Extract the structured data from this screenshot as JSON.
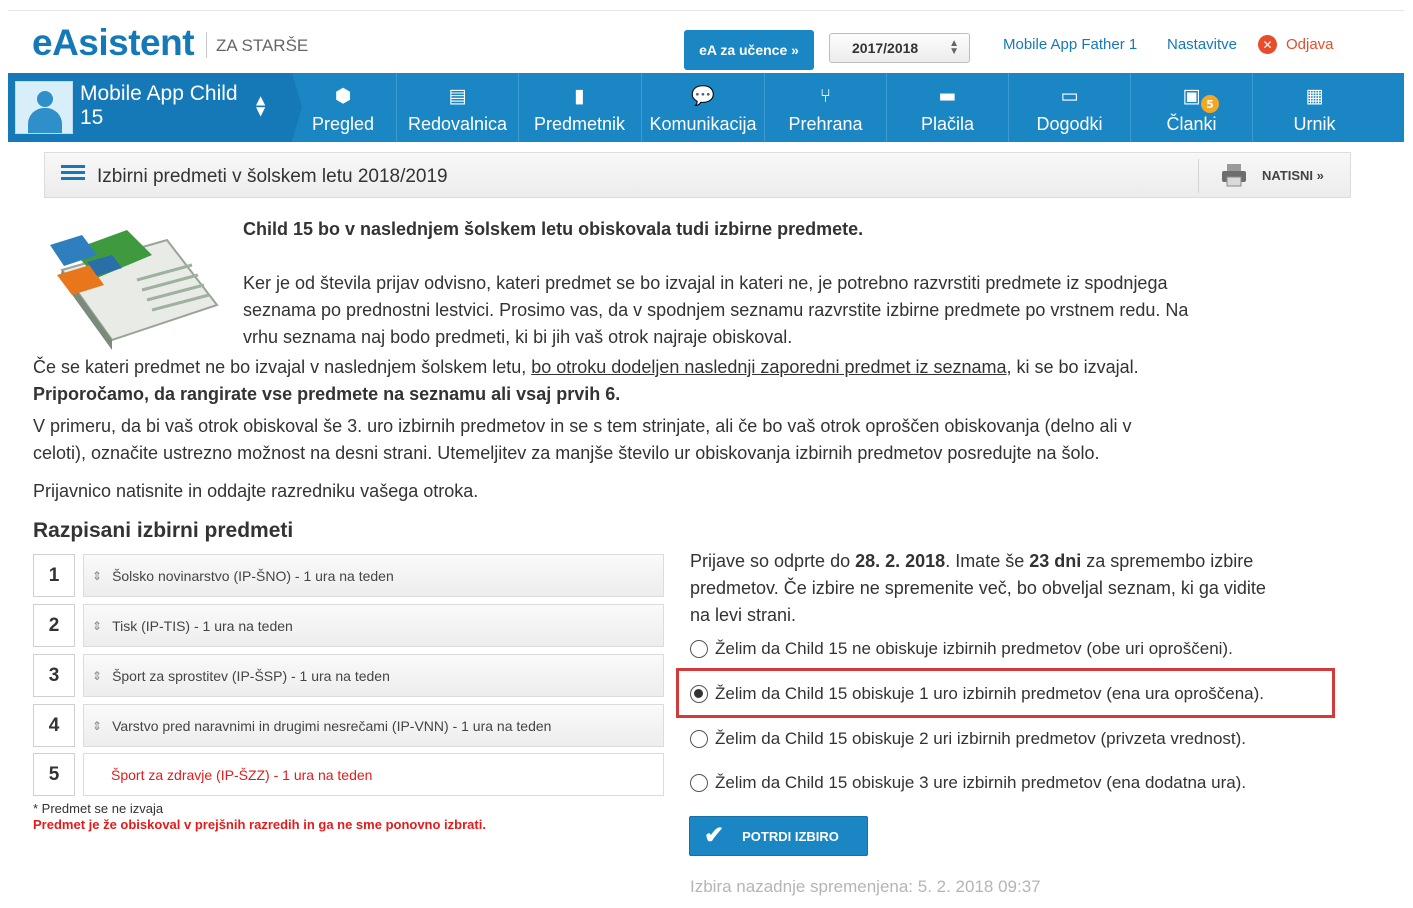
{
  "header": {
    "logo": "eAsistent",
    "logo_sub": "ZA STARŠE",
    "ea_button": "eA za učence »",
    "year": "2017/2018",
    "user": "Mobile App Father 1",
    "settings": "Nastavitve",
    "logout": "Odjava"
  },
  "nav": {
    "child_name": "Mobile App Child 15",
    "items": [
      {
        "label": "Pregled",
        "icon": "cube-icon"
      },
      {
        "label": "Redovalnica",
        "icon": "gradebook-icon"
      },
      {
        "label": "Predmetnik",
        "icon": "book-icon"
      },
      {
        "label": "Komunikacija",
        "icon": "chat-icon"
      },
      {
        "label": "Prehrana",
        "icon": "food-icon"
      },
      {
        "label": "Plačila",
        "icon": "card-icon"
      },
      {
        "label": "Dogodki",
        "icon": "ticket-icon"
      },
      {
        "label": "Članki",
        "icon": "articles-icon",
        "badge": "5"
      },
      {
        "label": "Urnik",
        "icon": "calendar-icon"
      }
    ]
  },
  "section": {
    "title": "Izbirni predmeti v šolskem letu 2018/2019",
    "print": "NATISNI »"
  },
  "content": {
    "heading": "Child 15 bo v naslednjem šolskem letu obiskovala tudi izbirne predmete.",
    "p1_line1": "Ker je od števila prijav odvisno, kateri predmet se bo izvajal in kateri ne, je potrebno razvrstiti predmete iz spodnjega",
    "p1_line2": "seznama po prednostni lestvici. Prosimo vas, da v spodnjem seznamu razvrstite izbirne predmete po vrstnem redu. Na",
    "p1_line3": "vrhu seznama naj bodo predmeti, ki bi jih vaš otrok najraje obiskoval.",
    "p2_start": "Če se kateri predmet ne bo izvajal v naslednjem šolskem letu, ",
    "p2_underline": "bo otroku dodeljen naslednji zaporedni predmet iz seznama",
    "p2_end": ", ki se bo izvajal.",
    "p2_bold": "Priporočamo, da rangirate vse predmete na seznamu ali vsaj prvih 6.",
    "p3_line1": "V primeru, da bi vaš otrok obiskoval še 3. uro izbirnih predmetov in se s tem strinjate, ali če bo vaš otrok oproščen obiskovanja (delno ali v",
    "p3_line2": "celoti), označite ustrezno možnost na desni strani. Utemeljitev za manjše število ur obiskovanja izbirnih predmetov posredujte na šolo.",
    "p4": "Prijavnico natisnite in oddajte razredniku vašega otroka."
  },
  "subjects": {
    "heading": "Razpisani izbirni predmeti",
    "items": [
      {
        "num": "1",
        "name": "Šolsko novinarstvo (IP-ŠNO) - 1 ura na teden"
      },
      {
        "num": "2",
        "name": "Tisk (IP-TIS) - 1 ura na teden"
      },
      {
        "num": "3",
        "name": "Šport za sprostitev (IP-ŠSP) - 1 ura na teden"
      },
      {
        "num": "4",
        "name": "Varstvo pred naravnimi in drugimi nesrečami (IP-VNN) - 1 ura na teden"
      },
      {
        "num": "5",
        "name": "Šport za zdravje (IP-ŠZZ) - 1 ura na teden"
      }
    ],
    "note1": "* Predmet se ne izvaja",
    "note2": "Predmet je že obiskoval v prejšnih razredih in ga ne sme ponovno izbrati."
  },
  "panel": {
    "l1_a": "Prijave so odprte do ",
    "l1_date": "28. 2. 2018",
    "l1_b": ". Imate še ",
    "l1_days": "23 dni",
    "l1_c": " za spremembo izbire",
    "l2": "predmetov. Če izbire ne spremenite več, bo obveljal seznam, ki ga vidite",
    "l3": "na levi strani.",
    "options": [
      {
        "label": "Želim da Child 15 ne obiskuje izbirnih predmetov (obe uri oproščeni).",
        "selected": false
      },
      {
        "label": "Želim da Child 15 obiskuje 1 uro izbirnih predmetov (ena ura oproščena).",
        "selected": true
      },
      {
        "label": "Želim da Child 15 obiskuje 2 uri izbirnih predmetov (privzeta vrednost).",
        "selected": false
      },
      {
        "label": "Želim da Child 15 obiskuje 3 ure izbirnih predmetov (ena dodatna ura).",
        "selected": false
      }
    ],
    "confirm": "POTRDI IZBIRO",
    "last_change": "Izbira nazadnje spremenjena: 5. 2. 2018 09:37"
  },
  "colors": {
    "brand": "#1a86c4",
    "brand_dark": "#1679b7",
    "danger": "#e21b1b",
    "highlight": "#d43a3a"
  }
}
